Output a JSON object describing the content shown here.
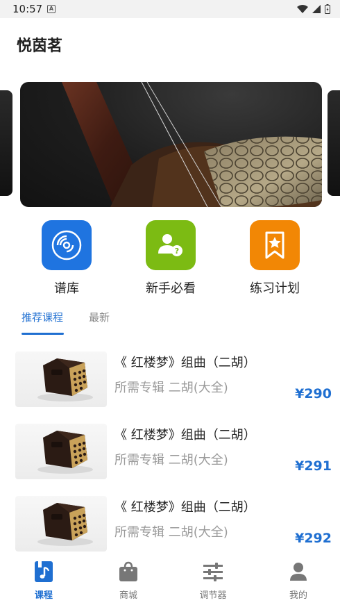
{
  "status": {
    "time": "10:57",
    "notif_icon": "a-notification-icon"
  },
  "app": {
    "title": "悦茵茗"
  },
  "quick_entries": [
    {
      "label": "谱库",
      "icon": "vinyl-disc-icon",
      "color": "#1f74e0"
    },
    {
      "label": "新手必看",
      "icon": "user-question-icon",
      "color": "#7cbb13"
    },
    {
      "label": "练习计划",
      "icon": "bookmark-star-icon",
      "color": "#f28705"
    }
  ],
  "tabs": [
    {
      "label": "推荐课程",
      "active": true
    },
    {
      "label": "最新",
      "active": false
    }
  ],
  "courses": [
    {
      "title": "《 红楼梦》组曲（二胡）",
      "subtitle": "所需专辑 二胡(大全)",
      "price": "¥290"
    },
    {
      "title": "《 红楼梦》组曲（二胡）",
      "subtitle": "所需专辑 二胡(大全)",
      "price": "¥291"
    },
    {
      "title": "《 红楼梦》组曲（二胡）",
      "subtitle": "所需专辑 二胡(大全)",
      "price": "¥292"
    }
  ],
  "bottom_nav": [
    {
      "label": "课程",
      "icon": "music-note-icon",
      "active": true
    },
    {
      "label": "商城",
      "icon": "shopping-bag-icon",
      "active": false
    },
    {
      "label": "调节器",
      "icon": "sliders-icon",
      "active": false
    },
    {
      "label": "我的",
      "icon": "person-icon",
      "active": false
    }
  ],
  "colors": {
    "accent": "#1f6fd1",
    "muted": "#9a9a9a"
  }
}
